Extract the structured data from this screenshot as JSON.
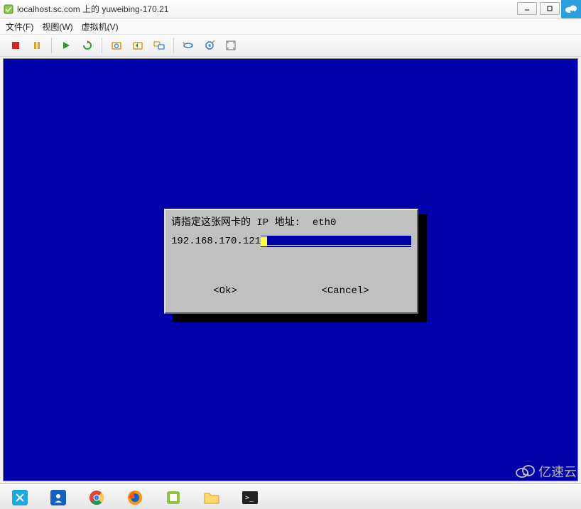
{
  "titlebar": {
    "text": "localhost.sc.com 上的 yuweibing-170.21"
  },
  "menu": {
    "file": "文件(F)",
    "view": "视图(W)",
    "vm": "虚拟机(V)"
  },
  "toolbar": {
    "stop": "stop",
    "pause": "pause",
    "play": "play",
    "restart": "restart",
    "snapshot_take": "snapshot-take",
    "snapshot_revert": "snapshot-revert",
    "snapshot_manage": "snapshot-manage",
    "devices": "devices",
    "settings": "settings",
    "fullscreen": "fullscreen"
  },
  "dialog": {
    "prompt_prefix": "请指定这张网卡的 IP 地址:  ",
    "interface": "eth0",
    "input_value": "192.168.170.121",
    "ok": "<Ok>",
    "cancel": "<Cancel>"
  },
  "watermark": {
    "text": "亿速云"
  }
}
